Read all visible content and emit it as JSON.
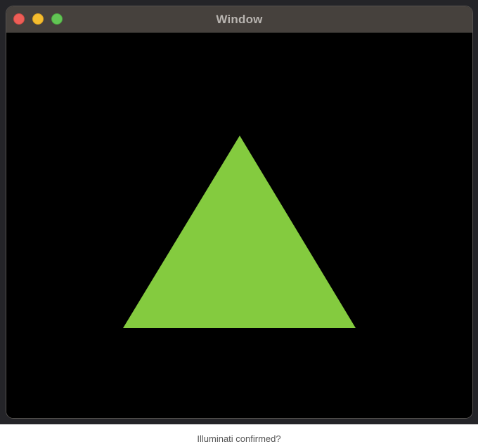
{
  "window": {
    "title": "Window",
    "buttons": {
      "close": "close-button",
      "minimize": "minimize-button",
      "zoom": "zoom-button"
    }
  },
  "canvas": {
    "background_color": "#000000",
    "triangle_color": "#84cb3f"
  },
  "caption": "Illuminati confirmed?"
}
